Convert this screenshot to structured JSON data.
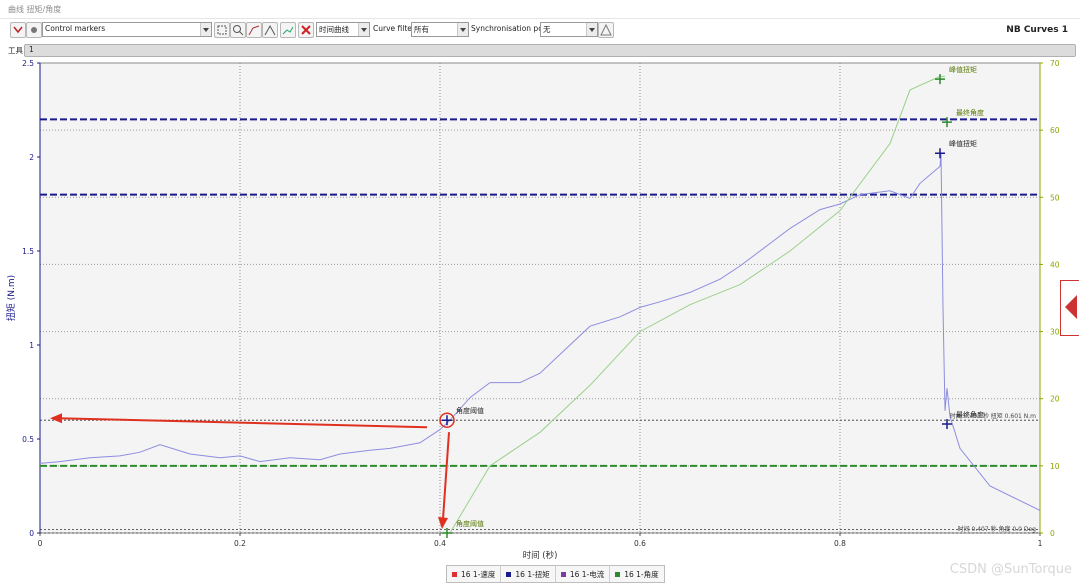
{
  "window": {
    "title": "曲线 扭矩/角度"
  },
  "toolbar": {
    "markers_combo": "Control markers",
    "time_curve_combo": "时间曲线",
    "curve_filter_label": "Curve filter",
    "filter_combo": "所有",
    "sync_label": "Synchronisation point",
    "sync_combo": "无",
    "panel_title": "NB Curves 1",
    "icons": [
      "csv-export-icon",
      "settings-icon",
      "zoom-fit-icon",
      "zoom-in-icon",
      "curve-icon",
      "curve-fit-icon",
      "chart-icon",
      "delete-icon",
      "warning-icon"
    ]
  },
  "tools": {
    "label": "工具",
    "value": "1"
  },
  "colors": {
    "speed": "#e03030",
    "torque": "#1a1a8c",
    "current": "#7a3aa0",
    "angle": "#2c8a2c",
    "torque_trace": "#8d8de0",
    "angle_trace": "#9ad18a",
    "annotation": "#e03020",
    "right_axis": "#8aa800"
  },
  "chart_data": {
    "type": "line",
    "xlabel": "时间 (秒)",
    "ylabel_left": "扭矩 (N.m)",
    "xlim": [
      0,
      1
    ],
    "ylim_left": [
      0,
      2.5
    ],
    "ylim_right": [
      0,
      70
    ],
    "x_ticks": [
      "0",
      "0.2",
      "0.4",
      "0.6",
      "0.8",
      "1"
    ],
    "y_left_ticks": [
      "0",
      "0.5",
      "1",
      "1.5",
      "2",
      "2.5"
    ],
    "y_right_ticks": [
      "0",
      "10",
      "20",
      "30",
      "40",
      "50",
      "60",
      "70"
    ],
    "grid": true,
    "legend_position": "bottom-center",
    "legend": [
      "16 1-速度",
      "16 1-扭矩",
      "16 1-电流",
      "16 1-角度"
    ],
    "series": [
      {
        "name": "16 1-扭矩",
        "axis": "left",
        "x": [
          0,
          0.02,
          0.05,
          0.08,
          0.1,
          0.12,
          0.15,
          0.18,
          0.2,
          0.22,
          0.25,
          0.28,
          0.3,
          0.33,
          0.35,
          0.38,
          0.4,
          0.41,
          0.43,
          0.45,
          0.48,
          0.5,
          0.52,
          0.55,
          0.58,
          0.6,
          0.62,
          0.65,
          0.68,
          0.7,
          0.72,
          0.75,
          0.78,
          0.8,
          0.82,
          0.85,
          0.87,
          0.88,
          0.9,
          0.901,
          0.903,
          0.905,
          0.907,
          0.91,
          0.92,
          0.95,
          1
        ],
        "y": [
          0.37,
          0.38,
          0.4,
          0.41,
          0.43,
          0.47,
          0.42,
          0.4,
          0.41,
          0.38,
          0.4,
          0.39,
          0.42,
          0.44,
          0.45,
          0.48,
          0.55,
          0.6,
          0.72,
          0.8,
          0.8,
          0.85,
          0.95,
          1.1,
          1.15,
          1.2,
          1.23,
          1.28,
          1.35,
          1.42,
          1.5,
          1.62,
          1.72,
          1.75,
          1.8,
          1.82,
          1.78,
          1.86,
          1.95,
          2.02,
          1.2,
          0.65,
          0.77,
          0.62,
          0.45,
          0.25,
          0.12
        ]
      },
      {
        "name": "16 1-角度",
        "axis": "right",
        "x": [
          0.41,
          0.43,
          0.45,
          0.48,
          0.5,
          0.55,
          0.6,
          0.65,
          0.7,
          0.75,
          0.8,
          0.85,
          0.87,
          0.9,
          0.905
        ],
        "y": [
          0,
          5,
          10,
          13,
          15,
          22,
          30,
          34,
          37,
          42,
          48,
          58,
          66,
          68,
          68
        ]
      }
    ],
    "thresholds": {
      "torque_left": [
        1.8,
        2.2
      ],
      "angle_right": [
        10,
        0.5
      ]
    },
    "annotations": [
      {
        "label": "角度阈值",
        "x": 0.407,
        "y": 0.6,
        "axis": "left"
      },
      {
        "label": "角度阈值",
        "x": 0.407,
        "y": 0,
        "axis": "right"
      },
      {
        "label": "峰值扭矩",
        "x": 0.9,
        "y": 2.02,
        "axis": "left"
      },
      {
        "label": "最终角度",
        "x": 0.907,
        "y": 0.58,
        "axis": "left"
      },
      {
        "label": "峰值扭矩",
        "x": 0.9,
        "y": 67.6,
        "axis": "right"
      },
      {
        "label": "最终角度",
        "x": 0.907,
        "y": 61.2,
        "axis": "right"
      }
    ],
    "notes": [
      {
        "text": "时间 0.407 秒 扭矩 0.601 N.m",
        "y": 0.6,
        "axis": "left"
      },
      {
        "text": "时间 0.407 秒 角度 0.0 Deg",
        "y": 0,
        "axis": "left"
      }
    ]
  },
  "watermark": "CSDN @SunTorque"
}
